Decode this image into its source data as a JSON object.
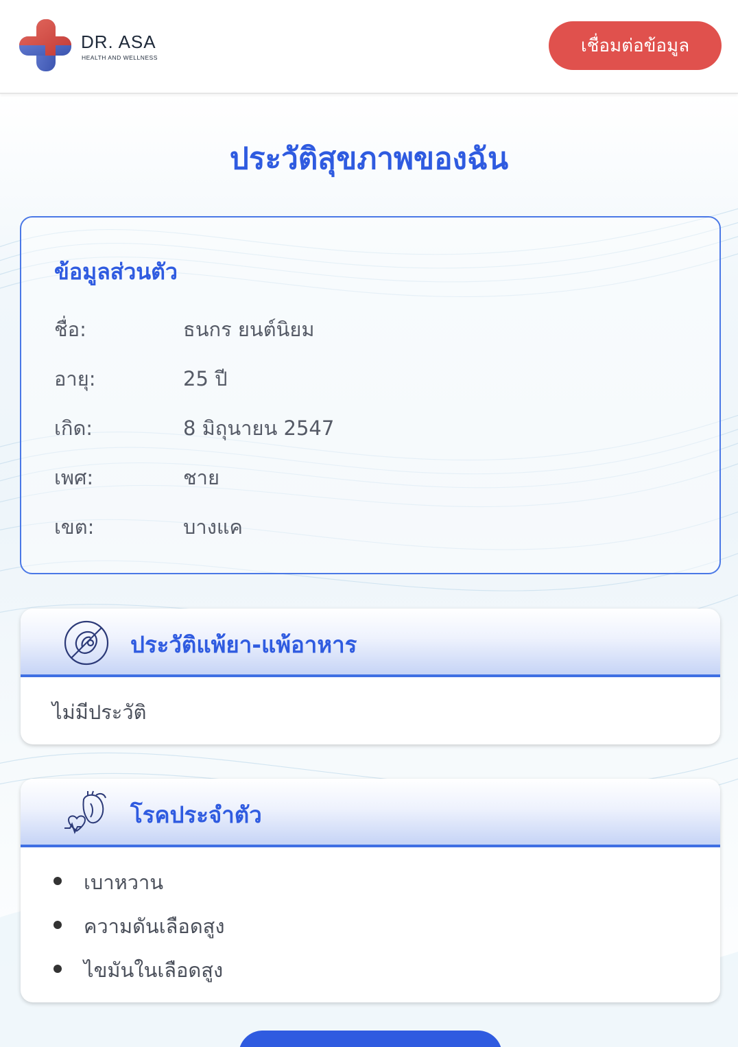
{
  "header": {
    "logo_title": "DR. ASA",
    "logo_subtitle": "HEALTH AND WELLNESS",
    "connect_button": "เชื่อมต่อข้อมูล"
  },
  "page_title": "ประวัติสุขภาพของฉัน",
  "personal_info": {
    "title": "ข้อมูลส่วนตัว",
    "rows": [
      {
        "label": "ชื่อ:",
        "value": "ธนกร ยนต์นิยม"
      },
      {
        "label": "อายุ:",
        "value": "25 ปี"
      },
      {
        "label": "เกิด:",
        "value": "8 มิถุนายน 2547"
      },
      {
        "label": "เพศ:",
        "value": "ชาย"
      },
      {
        "label": "เขต:",
        "value": "บางแค"
      }
    ]
  },
  "allergy": {
    "title": "ประวัติแพ้ยา-แพ้อาหาร",
    "icon": "no-allergy-icon",
    "body": "ไม่มีประวัติ"
  },
  "conditions": {
    "title": "โรคประจำตัว",
    "icon": "heart-organ-icon",
    "items": [
      "เบาหวาน",
      "ความดันเลือดสูง",
      "ไขมันในเลือดสูง"
    ]
  },
  "colors": {
    "primary": "#2f5be0",
    "accent": "#e0514d"
  }
}
